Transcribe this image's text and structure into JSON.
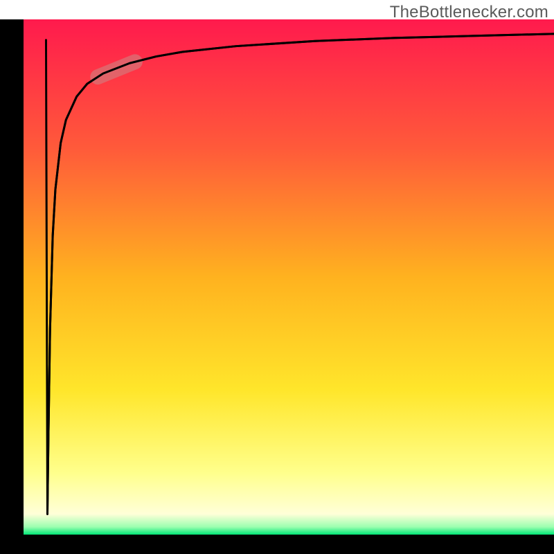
{
  "watermark": "TheBottlenecker.com",
  "chart_data": {
    "type": "line",
    "title": "",
    "xlabel": "",
    "ylabel": "",
    "xlim": [
      0,
      100
    ],
    "ylim": [
      0,
      100
    ],
    "background_gradient": {
      "stops": [
        {
          "offset": 0.0,
          "color": "#ff1a4d"
        },
        {
          "offset": 0.25,
          "color": "#ff5a3a"
        },
        {
          "offset": 0.5,
          "color": "#ffb21f"
        },
        {
          "offset": 0.72,
          "color": "#ffe62b"
        },
        {
          "offset": 0.88,
          "color": "#ffff8c"
        },
        {
          "offset": 0.96,
          "color": "#ffffd8"
        },
        {
          "offset": 0.985,
          "color": "#9cffb0"
        },
        {
          "offset": 1.0,
          "color": "#00e676"
        }
      ]
    },
    "frame": {
      "left_x": 32,
      "right_x": 100,
      "bottom_y": 3,
      "top_y": 100,
      "left_bar_width_frac": 0.04
    },
    "series": [
      {
        "name": "curve",
        "x": [
          4.5,
          4.7,
          5.0,
          5.5,
          6.0,
          7.0,
          8.0,
          10.0,
          12.0,
          15.0,
          20.0,
          25.0,
          30.0,
          40.0,
          55.0,
          70.0,
          85.0,
          100.0
        ],
        "y": [
          4.0,
          20.0,
          40.0,
          58.0,
          67.0,
          76.0,
          80.5,
          85.0,
          87.5,
          89.5,
          91.5,
          92.8,
          93.7,
          94.8,
          95.8,
          96.4,
          96.8,
          97.2
        ]
      }
    ],
    "highlight": {
      "on_series": "curve",
      "x_range": [
        14.0,
        21.0
      ],
      "color": "#d08080",
      "opacity": 0.62,
      "thickness_px": 22
    }
  }
}
